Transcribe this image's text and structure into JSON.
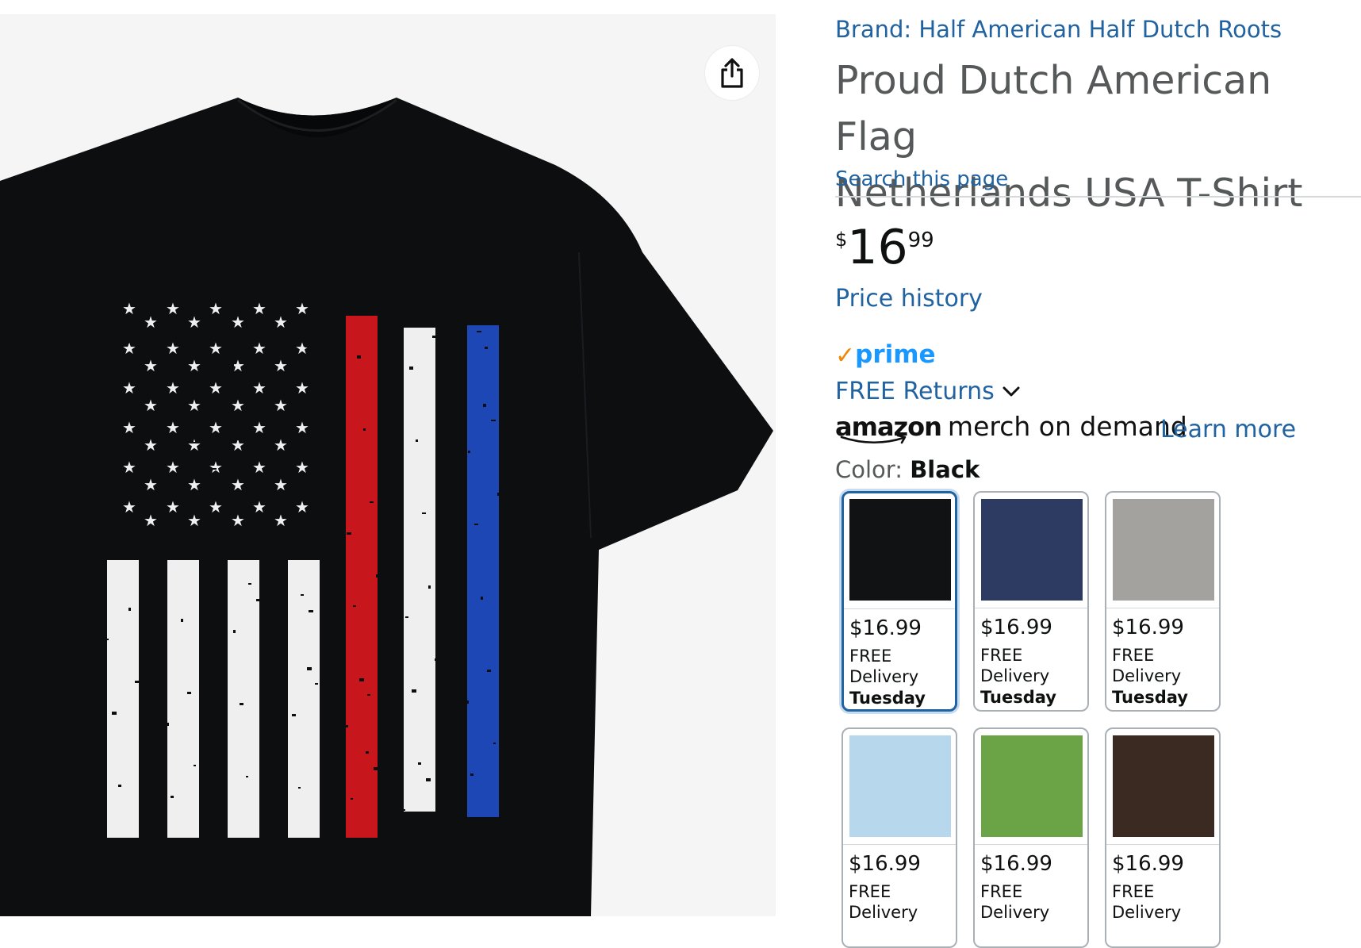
{
  "product": {
    "brand": "Brand: Half American Half Dutch Roots",
    "title": "Proud Dutch American Flag\nNetherlands USA T-Shirt",
    "search_this_page": "Search this page",
    "price": {
      "symbol": "$",
      "whole": "16",
      "fraction": "99"
    },
    "price_history": "Price history",
    "prime_label": "prime",
    "free_returns": "FREE Returns",
    "merch": {
      "brand": "amazon",
      "text": "merch on demand",
      "learn_more": "Learn more"
    },
    "color_label": "Color:",
    "color_value": "Black"
  },
  "colors": {
    "link": "#2162a1",
    "prime_blue": "#1a98ff",
    "prime_check": "#f08804",
    "selected_border": "#2162a1"
  },
  "icons": {
    "share": "share-icon",
    "chevron": "chevron-down-icon",
    "prime_check": "checkmark-icon"
  },
  "swatches": [
    {
      "color": "#101214",
      "price": "$16.99",
      "free": "FREE",
      "delivery": "Delivery",
      "day": "Tuesday",
      "selected": true
    },
    {
      "color": "#2d3a61",
      "price": "$16.99",
      "free": "FREE",
      "delivery": "Delivery",
      "day": "Tuesday",
      "selected": false
    },
    {
      "color": "#a4a29f",
      "price": "$16.99",
      "free": "FREE",
      "delivery": "Delivery",
      "day": "Tuesday",
      "selected": false
    },
    {
      "color": "#b6d7ec",
      "price": "$16.99",
      "free": "FREE",
      "delivery": "Delivery",
      "day": "",
      "selected": false
    },
    {
      "color": "#6aa447",
      "price": "$16.99",
      "free": "FREE",
      "delivery": "Delivery",
      "day": "",
      "selected": false
    },
    {
      "color": "#3b2a21",
      "price": "$16.99",
      "free": "FREE",
      "delivery": "Delivery",
      "day": "",
      "selected": false
    }
  ]
}
